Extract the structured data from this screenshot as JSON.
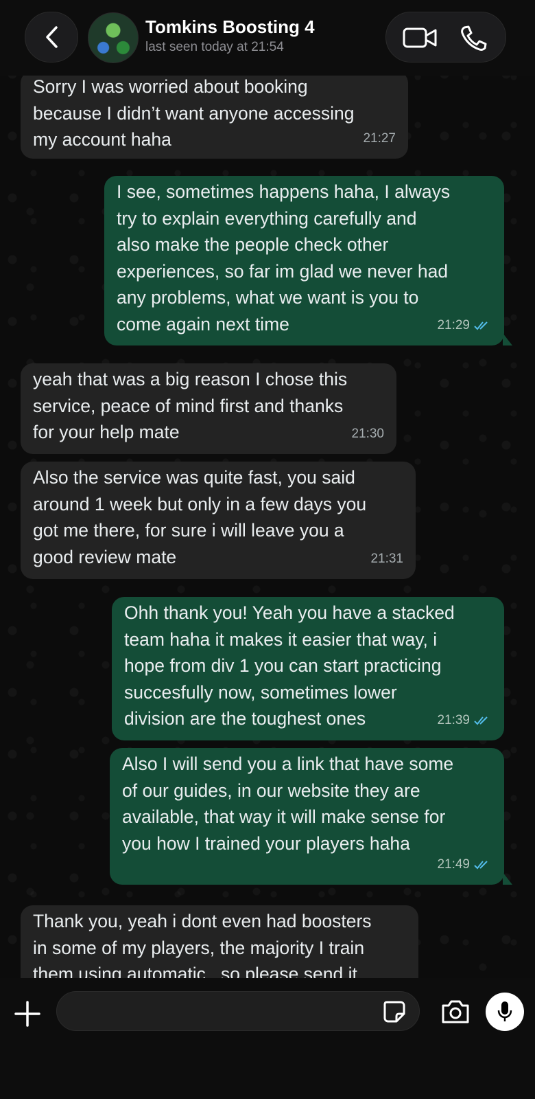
{
  "header": {
    "contact_name": "Tomkins Boosting 4",
    "status": "last seen today at 21:54"
  },
  "messages": [
    {
      "direction": "incoming",
      "text": "Sorry I was worried about booking\nbecause I didn’t want anyone accessing\nmy account haha",
      "time": "21:27"
    },
    {
      "direction": "outgoing",
      "text": "I see, sometimes happens haha,  I always\ntry to explain everything carefully and\nalso make the people check other\nexperiences, so far im glad we never had\nany problems, what we want is you to\ncome again next time",
      "time": "21:29",
      "status": "read"
    },
    {
      "direction": "incoming",
      "text": "yeah that was a big reason I chose this\nservice, peace of mind first and thanks\nfor your help mate",
      "time": "21:30"
    },
    {
      "direction": "incoming",
      "text": "Also the service was quite fast, you said\naround 1 week but only in a few days you\ngot me there, for sure i will leave you a\ngood review mate",
      "time": "21:31"
    },
    {
      "direction": "outgoing",
      "text": "Ohh thank you! Yeah you have a stacked\nteam haha it makes it easier that way, i\nhope from div 1 you can start practicing\nsuccesfully now, sometimes lower\ndivision are the toughest ones",
      "time": "21:39",
      "status": "read"
    },
    {
      "direction": "outgoing",
      "text": "Also I will send you a link that have some\nof our guides, in our website they are\navailable, that way it will make sense for\nyou how I trained your players haha",
      "time": "21:49",
      "status": "read"
    },
    {
      "direction": "incoming",
      "text": "Thank you, yeah i dont even had boosters\nin some of my players, the majority I train\nthem using automatic , so please send it",
      "time": ""
    }
  ],
  "input": {
    "value": "",
    "placeholder": ""
  },
  "icons": {
    "back": "chevron-left-icon",
    "video": "video-camera-icon",
    "phone": "phone-icon",
    "plus": "plus-icon",
    "sticker": "sticker-icon",
    "camera": "camera-icon",
    "mic": "microphone-icon"
  },
  "colors": {
    "outgoing_bubble": "#144d37",
    "incoming_bubble": "#232323",
    "read_ticks": "#53bdeb"
  }
}
